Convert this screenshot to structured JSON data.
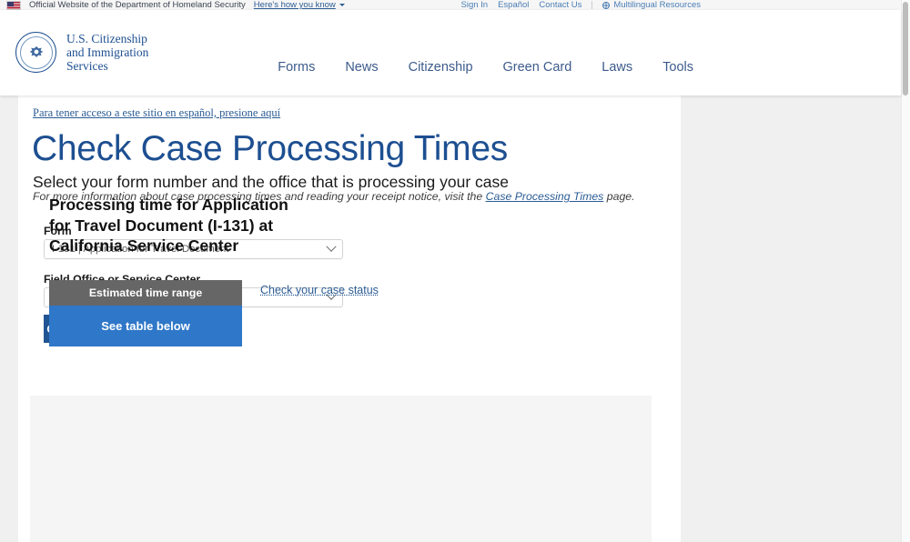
{
  "gov_banner": {
    "flag_icon": "us-flag-icon",
    "text": "Official Website of the Department of Homeland Security",
    "how_you_know_label": "Here's how you know",
    "chevron_icon": "chevron-down-icon",
    "sign_in": "Sign In",
    "espanol": "Español",
    "contact_us": "Contact Us",
    "globe_icon": "globe-icon",
    "multilingual": "Multilingual Resources"
  },
  "header": {
    "seal_icon": "dhs-seal-icon",
    "logo_line1": "U.S. Citizenship",
    "logo_line2": "and Immigration",
    "logo_line3": "Services",
    "nav": [
      {
        "label": "Forms"
      },
      {
        "label": "News"
      },
      {
        "label": "Citizenship"
      },
      {
        "label": "Green Card"
      },
      {
        "label": "Laws"
      },
      {
        "label": "Tools"
      }
    ]
  },
  "main": {
    "spanish_link": "Para tener acceso a este sitio en español, presione aquí",
    "title": "Check Case Processing Times",
    "subtitle": "Select your form number and the office that is processing your case",
    "note_prefix": "For more information about case processing times and reading your receipt notice, visit the ",
    "note_link": "Case Processing Times",
    "note_suffix": " page.",
    "form_label": "Form",
    "form_value": "I-131 | Application for Travel Document",
    "office_label": "Field Office or Service Center",
    "office_value": "California Service Center",
    "chevron_icon": "chevron-down-icon",
    "submit_label": "Get processing time"
  },
  "results": {
    "heading": "Processing time for Application for Travel Document (I-131) at California Service Center",
    "card_header": "Estimated time range",
    "card_body": "See table below",
    "case_status_link": "Check your case status",
    "colors": {
      "card_header_bg": "#666666",
      "card_body_bg": "#2f77c8",
      "button_bg": "#205493",
      "brand_blue": "#1d4f91",
      "link_blue": "#2b5c94"
    }
  },
  "scrollbar": {
    "name": "vertical-scrollbar"
  }
}
